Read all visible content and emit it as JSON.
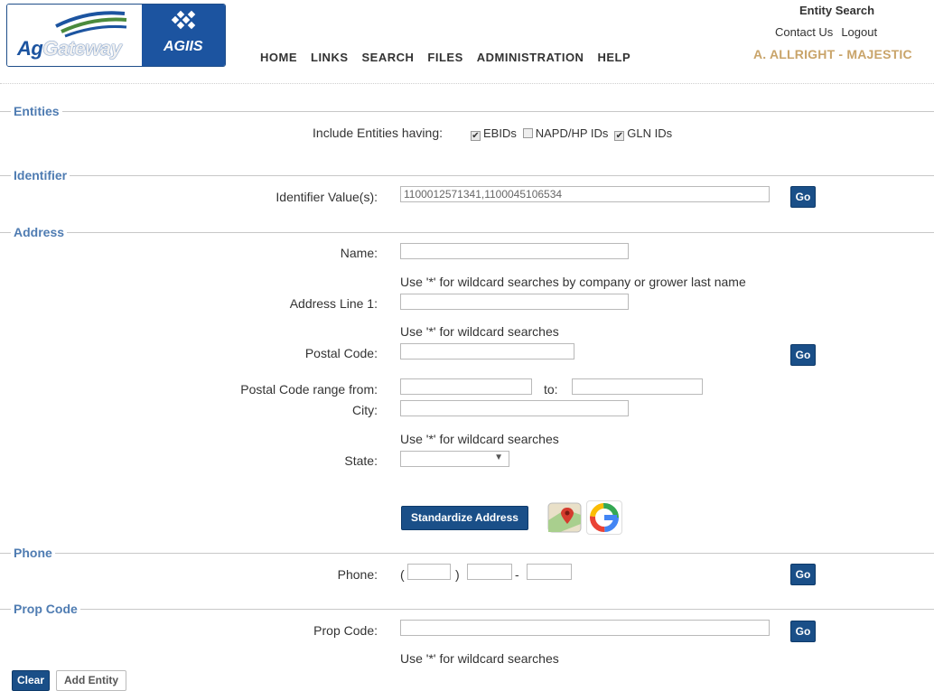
{
  "header": {
    "logo_ag": "Ag",
    "logo_gateway": "Gateway",
    "logo_agiis": "AGIIS",
    "nav": [
      "HOME",
      "LINKS",
      "SEARCH",
      "FILES",
      "ADMINISTRATION",
      "HELP"
    ],
    "page_title": "Entity Search",
    "contact_label": "Contact Us",
    "logout_label": "Logout",
    "user_name": "A. ALLRIGHT - MAJESTIC"
  },
  "entities": {
    "section_label": "Entities",
    "include_label": "Include Entities having:",
    "options": [
      {
        "label": "EBIDs",
        "checked": true
      },
      {
        "label": "NAPD/HP IDs",
        "checked": false
      },
      {
        "label": "GLN IDs",
        "checked": true
      }
    ]
  },
  "identifier": {
    "section_label": "Identifier",
    "value_label": "Identifier Value(s):",
    "value": "1100012571341,1100045106534",
    "go_label": "Go"
  },
  "address": {
    "section_label": "Address",
    "name_label": "Name:",
    "name_value": "",
    "name_hint": "Use '*' for wildcard searches by company or grower last name",
    "line1_label": "Address Line 1:",
    "line1_value": "",
    "line1_hint": "Use '*' for wildcard searches",
    "postal_label": "Postal Code:",
    "postal_value": "",
    "go_label": "Go",
    "range_label": "Postal Code range from:",
    "range_from": "",
    "range_to_label": "to:",
    "range_to": "",
    "city_label": "City:",
    "city_value": "",
    "city_hint": "Use '*' for wildcard searches",
    "state_label": "State:",
    "state_value": "",
    "standardize_label": "Standardize Address",
    "google_letter": "G"
  },
  "phone": {
    "section_label": "Phone",
    "phone_label": "Phone:",
    "open_paren": "(",
    "close_paren": ")",
    "dash": "-",
    "area": "",
    "prefix": "",
    "line": "",
    "go_label": "Go"
  },
  "propcode": {
    "section_label": "Prop Code",
    "prop_label": "Prop Code:",
    "prop_value": "",
    "go_label": "Go",
    "hint": "Use '*' for wildcard searches"
  },
  "footer": {
    "clear_label": "Clear",
    "add_entity_label": "Add Entity"
  },
  "colors": {
    "brand_blue": "#1c54a0",
    "section_label": "#4f7cb2",
    "user_name": "#c9a46a"
  }
}
